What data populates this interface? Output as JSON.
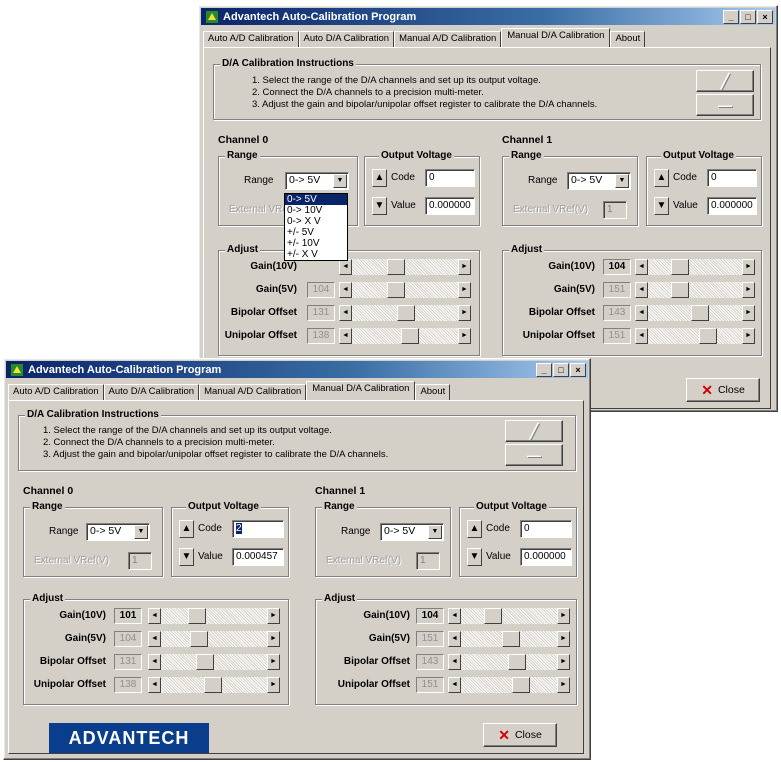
{
  "windows": {
    "title": "Advantech Auto-Calibration Program",
    "caption_buttons": [
      "_",
      "□",
      "×"
    ],
    "tabs": [
      "Auto A/D Calibration",
      "Auto D/A Calibration",
      "Manual A/D Calibration",
      "Manual D/A Calibration",
      "About"
    ],
    "active_tab": "Manual D/A Calibration",
    "instructions": {
      "title": "D/A Calibration Instructions",
      "steps": [
        "1. Select the range of the D/A channels and set up its output voltage.",
        "2. Connect the D/A channels to a precision multi-meter.",
        "3. Adjust the gain and bipolar/unipolar offset register to calibrate the D/A channels."
      ]
    },
    "labels": {
      "channel0": "Channel 0",
      "channel1": "Channel 1",
      "range_group": "Range",
      "range_label": "Range",
      "output_group": "Output Voltage",
      "code_label": "Code",
      "value_label": "Value",
      "external_label": "External VRef(V)",
      "adjust_group": "Adjust",
      "gain10": "Gain(10V)",
      "gain5": "Gain(5V)",
      "bipolar": "Bipolar Offset",
      "unipolar": "Unipolar Offset",
      "close": "Close",
      "spin_up": "▲",
      "spin_down": "▼",
      "select_arrow": "▼",
      "scroll_left": "◄",
      "scroll_right": "►"
    },
    "top": {
      "ch0": {
        "range": "0-> 5V",
        "external": "1",
        "code": "0",
        "value": "0.000000",
        "gain10": "",
        "gain5": "104",
        "bipolar": "131",
        "unipolar": "138"
      },
      "ch1": {
        "range": "0-> 5V",
        "external": "1",
        "code": "0",
        "value": "0.000000",
        "gain10": "104",
        "gain5": "151",
        "bipolar": "143",
        "unipolar": "151"
      },
      "dropdown_options": [
        "0-> 5V",
        "0-> 10V",
        "0-> X V",
        "+/- 5V",
        "+/- 10V",
        "+/- X V"
      ],
      "dropdown_selected": "0-> 5V"
    },
    "bottom": {
      "ch0": {
        "range": "0-> 5V",
        "external": "1",
        "code": "2",
        "value": "0.000457",
        "gain10": "101",
        "gain5": "104",
        "bipolar": "131",
        "unipolar": "138"
      },
      "ch1": {
        "range": "0-> 5V",
        "external": "1",
        "code": "0",
        "value": "0.000000",
        "gain10": "104",
        "gain5": "151",
        "bipolar": "143",
        "unipolar": "151"
      }
    },
    "logo_text": "ADVANTECH"
  },
  "colors": {
    "face": "#d4d0c8",
    "title_start": "#0a246a",
    "title_end": "#a6caf0",
    "close_x": "#d40000",
    "logo_bg": "#0a3d8c"
  },
  "icons": [
    "app-icon",
    "minimize-icon",
    "maximize-icon",
    "close-icon",
    "spin-up-icon",
    "spin-down-icon",
    "dropdown-arrow-icon",
    "scroll-left-icon",
    "scroll-right-icon",
    "close-x-icon"
  ]
}
